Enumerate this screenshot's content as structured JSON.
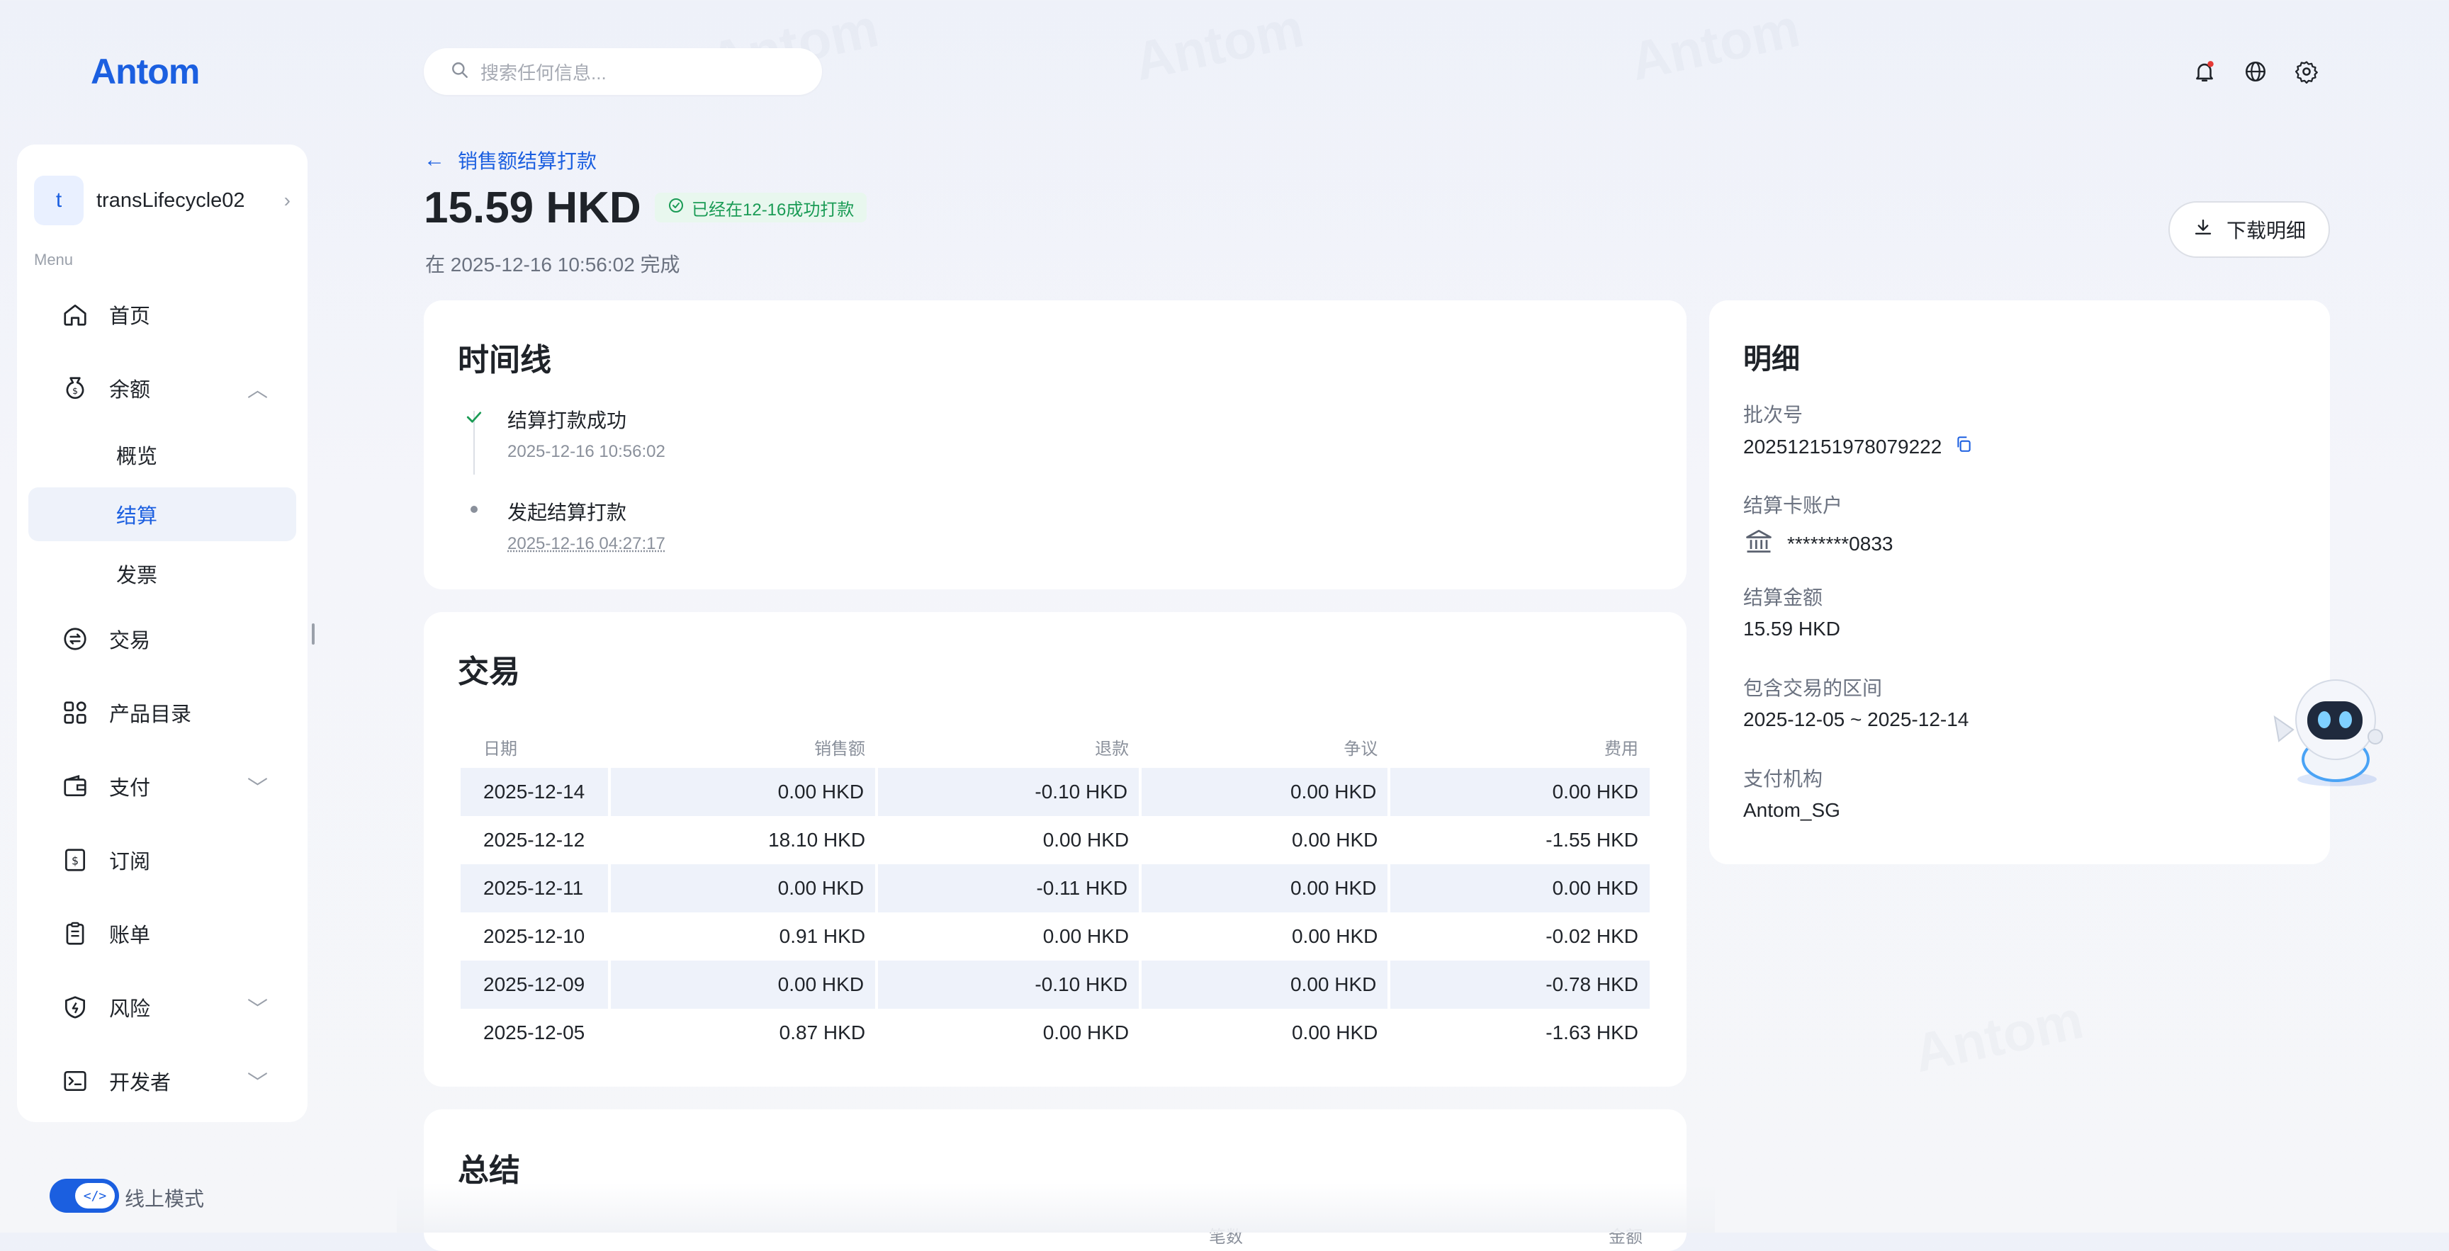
{
  "brand": {
    "logo": "Antom"
  },
  "search": {
    "placeholder": "搜索任何信息..."
  },
  "account": {
    "avatar_letter": "t",
    "name": "transLifecycle02"
  },
  "sidebar": {
    "menu_caption": "Menu",
    "items": [
      {
        "label": "首页",
        "icon": "home-icon"
      },
      {
        "label": "余额",
        "icon": "balance-icon"
      },
      {
        "label": "概览"
      },
      {
        "label": "结算"
      },
      {
        "label": "发票"
      },
      {
        "label": "交易",
        "icon": "exchange-icon"
      },
      {
        "label": "产品目录",
        "icon": "grid-icon"
      },
      {
        "label": "支付",
        "icon": "wallet-icon"
      },
      {
        "label": "订阅",
        "icon": "subscription-icon"
      },
      {
        "label": "账单",
        "icon": "bill-icon"
      },
      {
        "label": "风险",
        "icon": "shield-icon"
      },
      {
        "label": "开发者",
        "icon": "terminal-icon"
      }
    ],
    "mode_label": "线上模式",
    "mode_icon": "</>"
  },
  "header": {
    "back_label": "销售额结算打款",
    "amount": "15.59 HKD",
    "status": "已经在12-16成功打款",
    "completed": "在 2025-12-16 10:56:02 完成",
    "download_label": "下载明细"
  },
  "timeline": {
    "title": "时间线",
    "events": [
      {
        "label": "结算打款成功",
        "time": "2025-12-16 10:56:02"
      },
      {
        "label": "发起结算打款",
        "time": "2025-12-16 04:27:17"
      }
    ]
  },
  "transactions": {
    "title": "交易",
    "columns": [
      "日期",
      "销售额",
      "退款",
      "争议",
      "费用"
    ],
    "rows": [
      [
        "2025-12-14",
        "0.00 HKD",
        "-0.10 HKD",
        "0.00 HKD",
        "0.00 HKD"
      ],
      [
        "2025-12-12",
        "18.10 HKD",
        "0.00 HKD",
        "0.00 HKD",
        "-1.55 HKD"
      ],
      [
        "2025-12-11",
        "0.00 HKD",
        "-0.11 HKD",
        "0.00 HKD",
        "0.00 HKD"
      ],
      [
        "2025-12-10",
        "0.91 HKD",
        "0.00 HKD",
        "0.00 HKD",
        "-0.02 HKD"
      ],
      [
        "2025-12-09",
        "0.00 HKD",
        "-0.10 HKD",
        "0.00 HKD",
        "-0.78 HKD"
      ],
      [
        "2025-12-05",
        "0.87 HKD",
        "0.00 HKD",
        "0.00 HKD",
        "-1.63 HKD"
      ]
    ]
  },
  "summary": {
    "title": "总结",
    "col1": "笔数",
    "col2": "金额"
  },
  "details": {
    "title": "明细",
    "batch_label": "批次号",
    "batch_value": "202512151978079222",
    "card_label": "结算卡账户",
    "card_value": "********0833",
    "amount_label": "结算金额",
    "amount_value": "15.59 HKD",
    "range_label": "包含交易的区间",
    "range_value": "2025-12-05 ~ 2025-12-14",
    "org_label": "支付机构",
    "org_value": "Antom_SG"
  },
  "colors": {
    "accent": "#1b5fe0",
    "success": "#1a9b55",
    "row_shade": "#eef2fa"
  }
}
